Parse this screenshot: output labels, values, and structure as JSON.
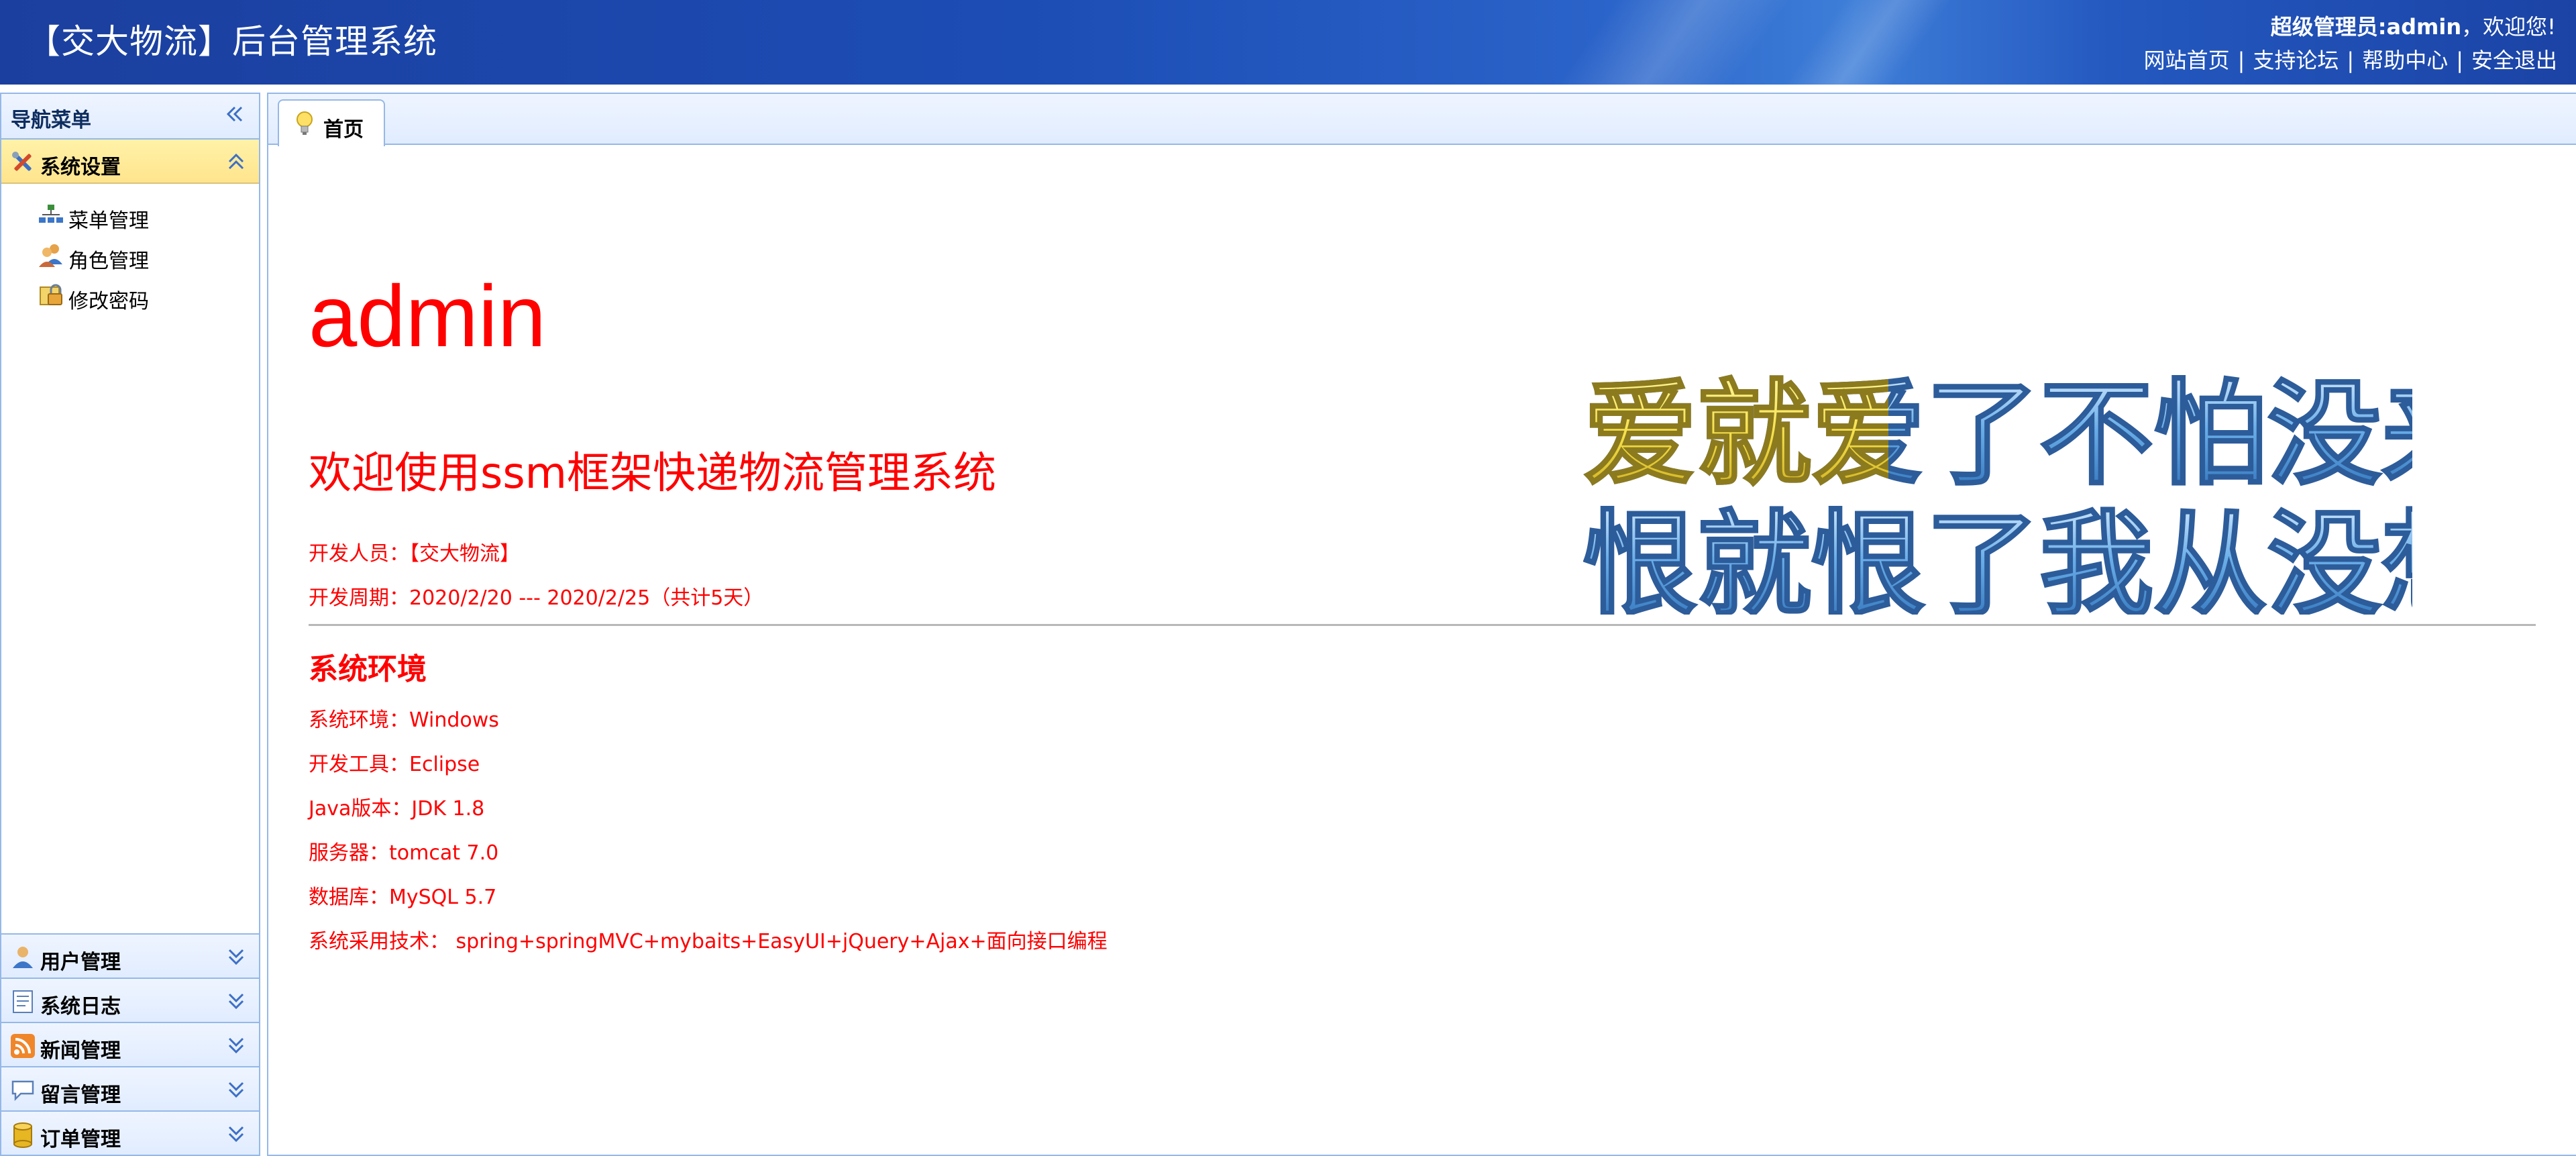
{
  "header": {
    "app_title": "【交大物流】后台管理系统",
    "user_role": "超级管理员:admin",
    "user_greeting": "，欢迎您!",
    "links": [
      "网站首页",
      "支持论坛",
      "帮助中心",
      "安全退出"
    ],
    "separator": "|"
  },
  "sidebar": {
    "title": "导航菜单",
    "active_section": {
      "label": "系统设置",
      "items": [
        {
          "label": "菜单管理",
          "icon": "sitemap-icon"
        },
        {
          "label": "角色管理",
          "icon": "users-icon"
        },
        {
          "label": "修改密码",
          "icon": "lock-icon"
        }
      ]
    },
    "collapsed_sections": [
      {
        "label": "用户管理",
        "icon": "user-icon"
      },
      {
        "label": "系统日志",
        "icon": "log-icon"
      },
      {
        "label": "新闻管理",
        "icon": "rss-icon"
      },
      {
        "label": "留言管理",
        "icon": "comment-icon"
      },
      {
        "label": "订单管理",
        "icon": "database-icon"
      }
    ]
  },
  "tabs": [
    {
      "label": "首页",
      "icon": "lightbulb-icon"
    }
  ],
  "home": {
    "username": "admin",
    "welcome": "欢迎使用ssm框架快递物流管理系统",
    "developer": "开发人员：【交大物流】",
    "period": "开发周期：2020/2/20 --- 2020/2/25（共计5天）",
    "env_title": "系统环境",
    "env": [
      "系统环境：Windows",
      "开发工具：Eclipse",
      "Java版本：JDK 1.8",
      "服务器：tomcat 7.0",
      "数据库：MySQL 5.7",
      "系统采用技术： spring+springMVC+mybaits+EasyUI+jQuery+Ajax+面向接口编程"
    ],
    "slogan_line1": "爱就爱了不怕没来过",
    "slogan_line2": "恨就恨了我从没想过"
  },
  "colors": {
    "header_blue": "#1c4db5",
    "panel_border": "#95b8e7",
    "active_section": "#ffe48d",
    "content_text": "#ff0000",
    "slogan_yellow": "#f5e04a",
    "slogan_blue": "#4a90d9"
  }
}
